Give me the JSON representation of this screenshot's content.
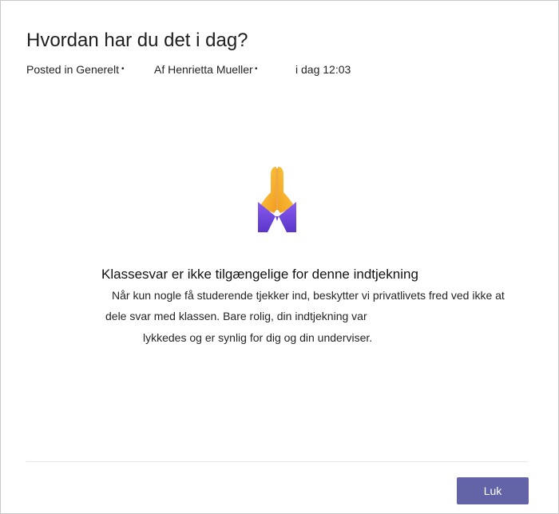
{
  "post": {
    "title": "Hvordan har du det i dag?",
    "meta": {
      "channel": "Posted in Generelt",
      "author": "Af Henrietta Mueller",
      "time": "i dag 12:03",
      "separator": "•"
    }
  },
  "illustration": {
    "icon": "folded-hands-icon"
  },
  "message": {
    "heading": "Klassesvar er ikke tilgængelige for denne indtjekning",
    "line1": "Når kun nogle få studerende tjekker ind, beskytter vi privatlivets fred ved ikke at",
    "line2": "dele svar med klassen. Bare rolig, din indtjekning var",
    "line3": "lykkedes og er synlig for dig og din underviser."
  },
  "footer": {
    "close_label": "Luk"
  },
  "colors": {
    "accent": "#6264a7",
    "emoji_yellow": "#f7b531",
    "emoji_purple": "#7b4ee0"
  }
}
